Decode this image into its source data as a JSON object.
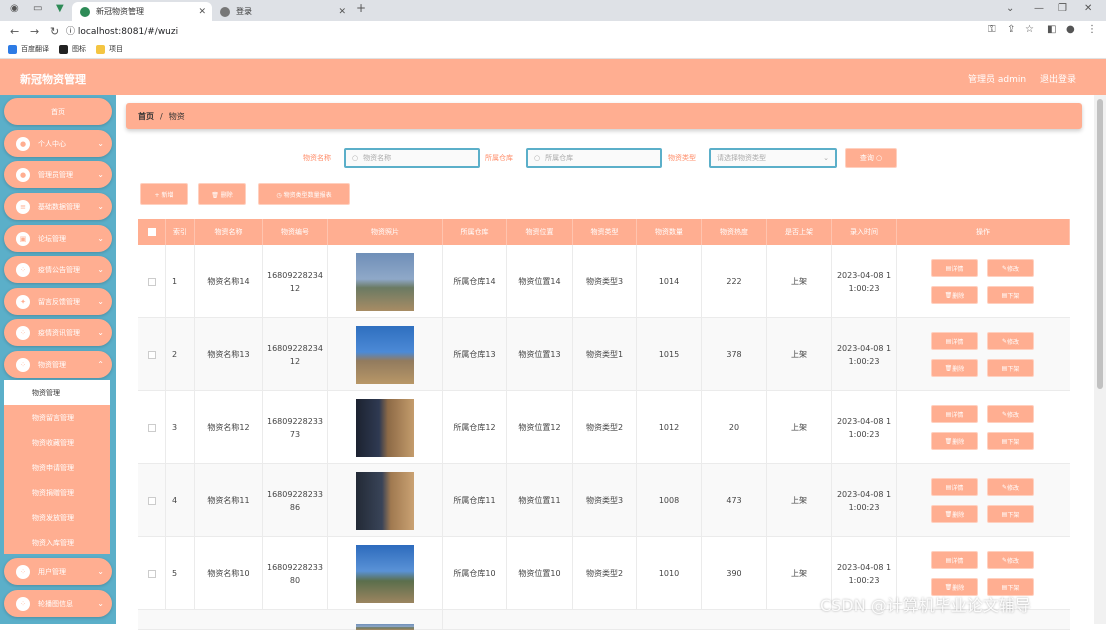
{
  "browser": {
    "tabs": [
      {
        "label": "新冠物资管理"
      },
      {
        "label": "登录"
      }
    ],
    "new_tab": "+",
    "url": "localhost:8081/#/wuzi",
    "bookmarks": [
      {
        "label": "百度翻译"
      },
      {
        "label": "图标"
      },
      {
        "label": "项目"
      }
    ]
  },
  "header": {
    "title": "新冠物资管理",
    "user": "管理员 admin",
    "logout": "退出登录"
  },
  "sidebar": {
    "items": [
      {
        "label": "首页"
      },
      {
        "label": "个人中心"
      },
      {
        "label": "管理员管理"
      },
      {
        "label": "基础数据管理"
      },
      {
        "label": "论坛管理"
      },
      {
        "label": "疫情公告管理"
      },
      {
        "label": "留言反馈管理"
      },
      {
        "label": "疫情资讯管理"
      },
      {
        "label": "物资管理"
      },
      {
        "label": "用户管理"
      },
      {
        "label": "轮播图信息"
      }
    ],
    "submenu": [
      {
        "label": "物资管理"
      },
      {
        "label": "物资留言管理"
      },
      {
        "label": "物资收藏管理"
      },
      {
        "label": "物资申请管理"
      },
      {
        "label": "物资捐赠管理"
      },
      {
        "label": "物资发放管理"
      },
      {
        "label": "物资入库管理"
      }
    ]
  },
  "breadcrumb": {
    "home": "首页",
    "sep": "/",
    "current": "物资"
  },
  "search": {
    "name_label": "物资名称",
    "name_placeholder": "物资名称",
    "warehouse_label": "所属仓库",
    "warehouse_placeholder": "所属仓库",
    "type_label": "物资类型",
    "type_placeholder": "请选择物资类型",
    "button": "查询 ○"
  },
  "actions": {
    "add": "+ 新增",
    "delete": "🗑 删除",
    "stats": "◷ 物资类型数量报表"
  },
  "table": {
    "headers": [
      "索引",
      "物资名称",
      "物资编号",
      "物资照片",
      "所属仓库",
      "物资位置",
      "物资类型",
      "物资数量",
      "物资热度",
      "是否上架",
      "录入时间",
      "操作"
    ],
    "op_labels": {
      "detail": "详情",
      "edit": "修改",
      "delete": "删除",
      "offshelf": "下架"
    },
    "rows": [
      {
        "index": "1",
        "name": "物资名称14",
        "code": "16809228234 12",
        "warehouse": "所属仓库14",
        "location": "物资位置14",
        "type": "物资类型3",
        "qty": "1014",
        "heat": "222",
        "shelf": "上架",
        "time": "2023-04-08 1 1:00:23"
      },
      {
        "index": "2",
        "name": "物资名称13",
        "code": "16809228234 12",
        "warehouse": "所属仓库13",
        "location": "物资位置13",
        "type": "物资类型1",
        "qty": "1015",
        "heat": "378",
        "shelf": "上架",
        "time": "2023-04-08 1 1:00:23"
      },
      {
        "index": "3",
        "name": "物资名称12",
        "code": "16809228233 73",
        "warehouse": "所属仓库12",
        "location": "物资位置12",
        "type": "物资类型2",
        "qty": "1012",
        "heat": "20",
        "shelf": "上架",
        "time": "2023-04-08 1 1:00:23"
      },
      {
        "index": "4",
        "name": "物资名称11",
        "code": "16809228233 86",
        "warehouse": "所属仓库11",
        "location": "物资位置11",
        "type": "物资类型3",
        "qty": "1008",
        "heat": "473",
        "shelf": "上架",
        "time": "2023-04-08 1 1:00:23"
      },
      {
        "index": "5",
        "name": "物资名称10",
        "code": "16809228233 80",
        "warehouse": "所属仓库10",
        "location": "物资位置10",
        "type": "物资类型2",
        "qty": "1010",
        "heat": "390",
        "shelf": "上架",
        "time": "2023-04-08 1 1:00:23"
      }
    ]
  },
  "watermark": "CSDN @计算机毕业论文辅导",
  "colors": {
    "accent": "#ffae91",
    "sidebar_bg": "#5bafc9",
    "label": "#ff8c68"
  }
}
